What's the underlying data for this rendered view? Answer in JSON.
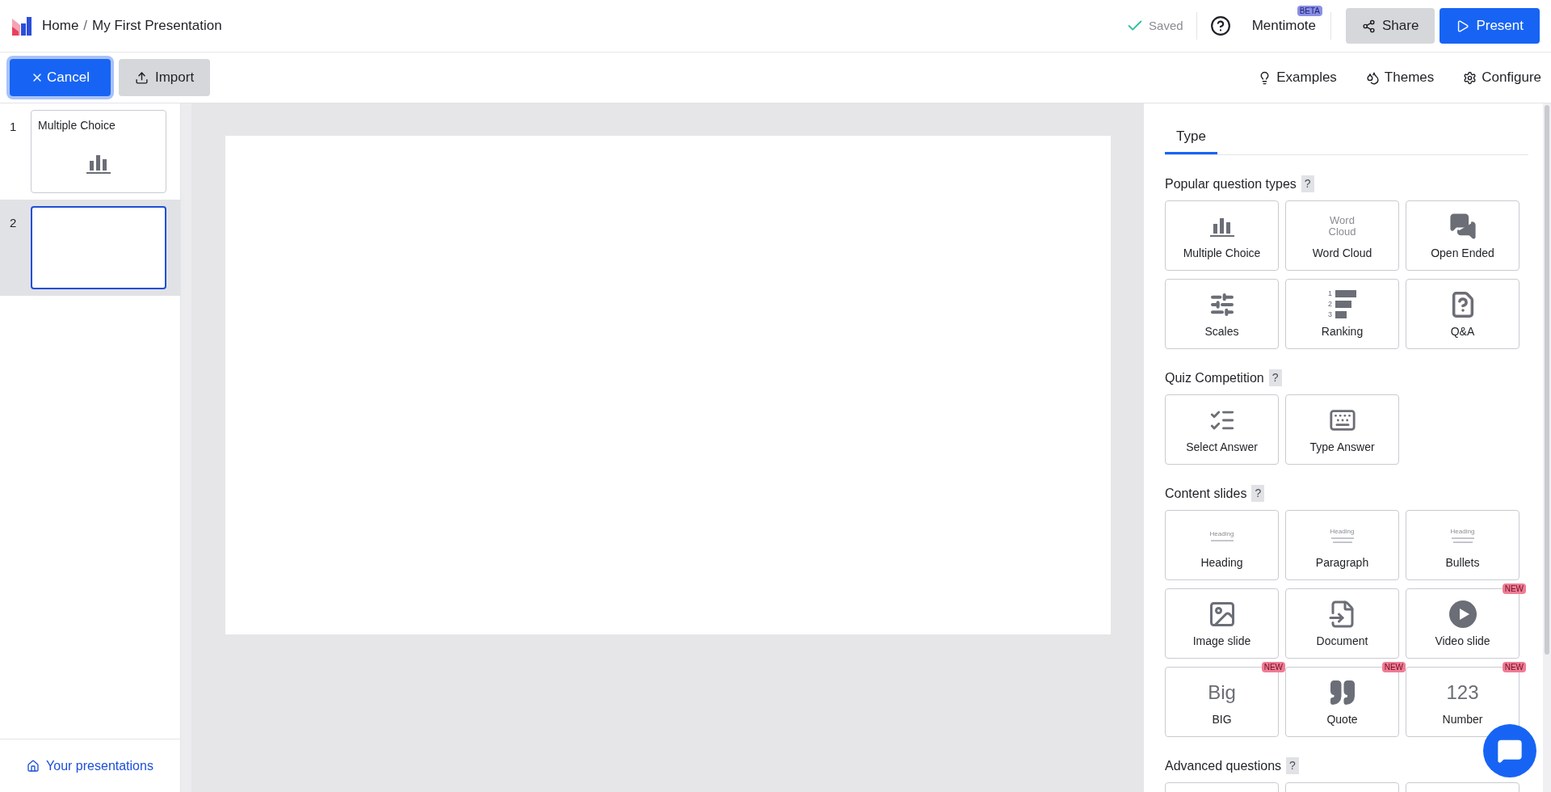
{
  "header": {
    "breadcrumb": [
      {
        "label": "Home"
      },
      {
        "label": "My First Presentation"
      }
    ],
    "separator": "/",
    "save_status": "Saved",
    "mentimote": {
      "label": "Mentimote",
      "badge": "BETA"
    },
    "buttons": [
      {
        "label": "Share",
        "kind": "secondary"
      },
      {
        "label": "Present",
        "kind": "primary"
      }
    ]
  },
  "toolbar": {
    "left": [
      {
        "label": "Cancel",
        "kind": "primary"
      },
      {
        "label": "Import",
        "kind": "secondary"
      }
    ],
    "right": [
      {
        "label": "Examples"
      },
      {
        "label": "Themes"
      },
      {
        "label": "Configure"
      }
    ]
  },
  "slides": [
    {
      "number": "1",
      "title": "Multiple Choice",
      "selected": false
    },
    {
      "number": "2",
      "selected": true
    }
  ],
  "sidebar_link": "Your presentations",
  "panel": {
    "tabs": [
      {
        "label": "Type",
        "selected": true
      }
    ],
    "sections": [
      {
        "title": "Popular question types",
        "help": "?",
        "tiles": [
          {
            "kind": "full",
            "label": "Multiple Choice"
          },
          {
            "kind": "full",
            "label": "Word Cloud",
            "preview_lines": [
              "Word",
              "Cloud"
            ]
          },
          {
            "kind": "full",
            "label": "Open Ended"
          },
          {
            "kind": "full",
            "label": "Scales"
          },
          {
            "kind": "full",
            "label": "Ranking",
            "preview_lines": [
              "1",
              "2",
              "3"
            ]
          },
          {
            "kind": "full",
            "label": "Q&A"
          }
        ]
      },
      {
        "title": "Quiz Competition",
        "help": "?",
        "tiles": [
          {
            "kind": "full",
            "label": "Select Answer"
          },
          {
            "kind": "full",
            "label": "Type Answer"
          }
        ]
      },
      {
        "title": "Content slides",
        "help": "?",
        "tiles": [
          {
            "kind": "full",
            "label": "Heading",
            "preview_lines": [
              "Heading"
            ]
          },
          {
            "kind": "full",
            "label": "Paragraph",
            "preview_lines": [
              "Heading"
            ]
          },
          {
            "kind": "full",
            "label": "Bullets",
            "preview_lines": [
              "Heading"
            ]
          },
          {
            "kind": "full",
            "label": "Image slide"
          },
          {
            "kind": "full",
            "label": "Document"
          },
          {
            "kind": "full",
            "label": "Video slide",
            "badge": "NEW"
          },
          {
            "kind": "full",
            "label": "BIG",
            "badge": "NEW",
            "preview_lines": [
              "Big"
            ]
          },
          {
            "kind": "full",
            "label": "Quote",
            "badge": "NEW"
          },
          {
            "kind": "full",
            "label": "Number",
            "badge": "NEW",
            "preview_lines": [
              "123"
            ]
          }
        ]
      },
      {
        "title": "Advanced questions",
        "help": "?",
        "tiles": [
          {
            "kind": "partial"
          },
          {
            "kind": "partial"
          },
          {
            "kind": "partial"
          }
        ]
      }
    ]
  }
}
